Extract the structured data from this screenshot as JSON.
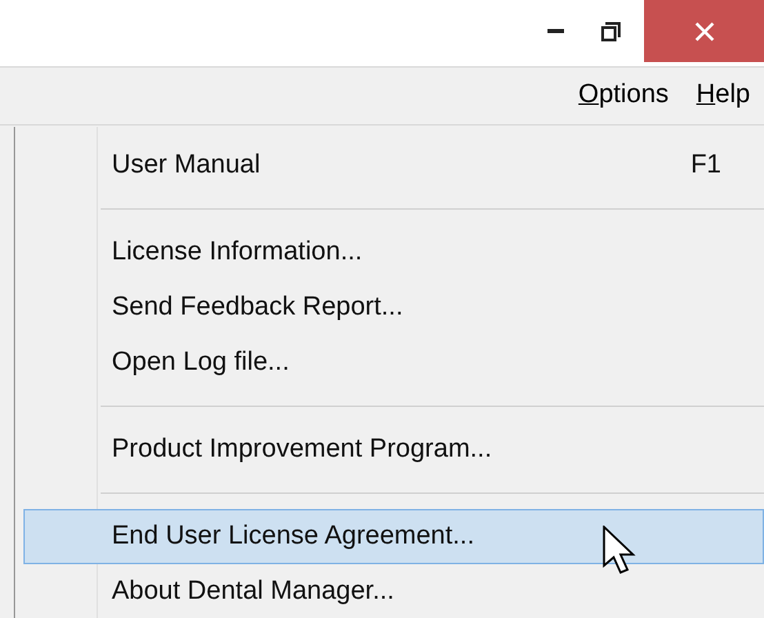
{
  "menu_bar": [
    {
      "label": "Options"
    },
    {
      "label": "Help"
    }
  ],
  "menu": [
    {
      "kind": "item",
      "label": "User Manual",
      "shortcut": "F1",
      "selected": false
    },
    {
      "kind": "separator"
    },
    {
      "kind": "item",
      "label": "License Information...",
      "selected": false
    },
    {
      "kind": "item",
      "label": "Send Feedback Report...",
      "selected": false
    },
    {
      "kind": "item",
      "label": "Open Log file...",
      "selected": false
    },
    {
      "kind": "separator"
    },
    {
      "kind": "item",
      "label": "Product Improvement Program...",
      "selected": false
    },
    {
      "kind": "separator"
    },
    {
      "kind": "item",
      "label": "End User License Agreement...",
      "selected": true
    },
    {
      "kind": "item",
      "label": "About Dental Manager...",
      "selected": false
    }
  ]
}
